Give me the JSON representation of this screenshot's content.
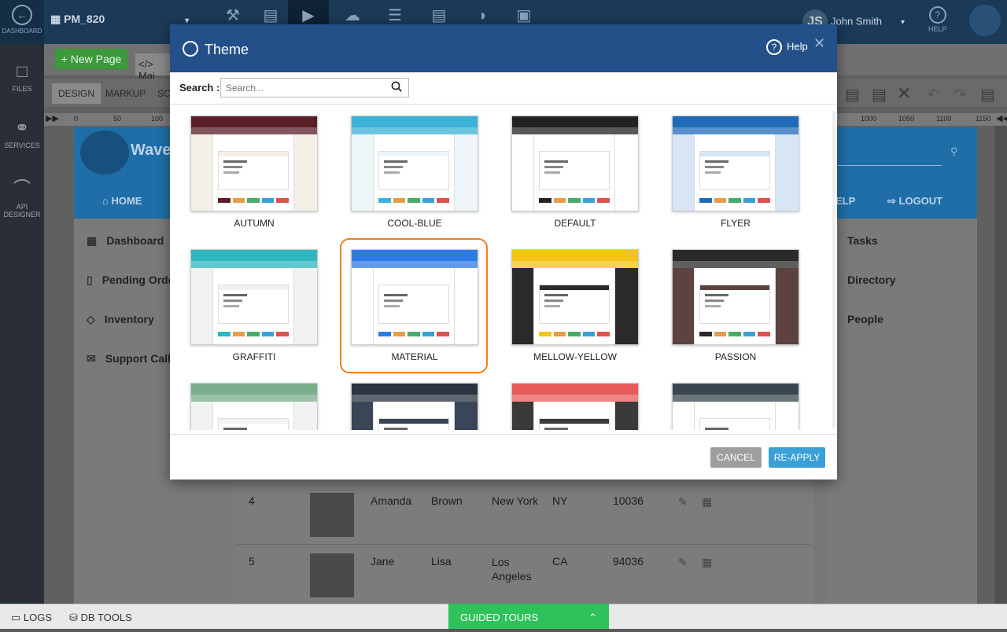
{
  "topbar": {
    "dashboard_label": "DASHBOARD",
    "project_name": "PM_820",
    "user_initials": "JS",
    "user_name": "John Smith",
    "help_label": "HELP"
  },
  "rail": [
    {
      "label": "FILES",
      "icon": "folder-icon"
    },
    {
      "label": "SERVICES",
      "icon": "services-icon"
    },
    {
      "label": "API DESIGNER",
      "icon": "api-designer-icon"
    }
  ],
  "editor": {
    "new_page_label": "New Page",
    "page_tab_label": "Mai",
    "tabs": [
      "DESIGN",
      "MARKUP",
      "SC"
    ],
    "ruler_left": [
      "0",
      "50",
      "100"
    ],
    "ruler_right": [
      "1000",
      "1050",
      "1100",
      "1150"
    ],
    "app_brand": "Wave",
    "home_label": "HOME",
    "help_label": "ELP",
    "logout_label": "LOGOUT",
    "sidebar": [
      "Dashboard",
      "Pending Orde",
      "Inventory",
      "Support Calls"
    ],
    "rightcol": [
      "Tasks",
      "Directory",
      "People"
    ],
    "rows": [
      {
        "id": "4",
        "first": "Amanda",
        "last": "Brown",
        "city": "New York",
        "state": "NY",
        "zip": "10036"
      },
      {
        "id": "5",
        "first": "Jane",
        "last": "Lisa",
        "city": "Los Angeles",
        "state": "CA",
        "zip": "94036"
      }
    ]
  },
  "bottombar": {
    "logs_label": "LOGS",
    "dbtools_label": "DB TOOLS",
    "guided_label": "GUIDED TOURS"
  },
  "modal": {
    "title": "Theme",
    "help_label": "Help",
    "search_label": "Search :",
    "search_placeholder": "Search...",
    "cancel_label": "CANCEL",
    "reapply_label": "RE-APPLY",
    "selected": "MATERIAL",
    "themes": [
      {
        "name": "AUTUMN",
        "bar": "#5a1e28",
        "side": "#f4f0e8"
      },
      {
        "name": "COOL-BLUE",
        "bar": "#3bb2d6",
        "side": "#eef6fa"
      },
      {
        "name": "DEFAULT",
        "bar": "#222222",
        "side": "#ffffff"
      },
      {
        "name": "FLYER",
        "bar": "#1f6bb8",
        "side": "#d6e6f4"
      },
      {
        "name": "GRAFFITI",
        "bar": "#2fb7c1",
        "side": "#f2f2f2"
      },
      {
        "name": "MATERIAL",
        "bar": "#2c7be5",
        "side": "#ffffff"
      },
      {
        "name": "MELLOW-YELLOW",
        "bar": "#f3c316",
        "side": "#2a2a2a"
      },
      {
        "name": "PASSION",
        "bar": "#2a2a2a",
        "side": "#5e4240"
      },
      {
        "name": "",
        "bar": "#7aae8c",
        "side": "#f2f2f2"
      },
      {
        "name": "",
        "bar": "#2b3440",
        "side": "#3a4658"
      },
      {
        "name": "",
        "bar": "#e85b5b",
        "side": "#3a3a3a"
      },
      {
        "name": "",
        "bar": "#3a4750",
        "side": "#ffffff"
      }
    ]
  }
}
